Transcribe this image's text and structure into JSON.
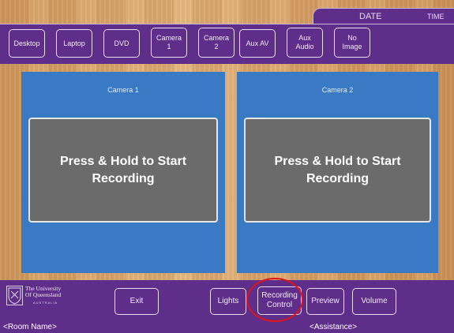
{
  "header": {
    "date_label": "DATE",
    "time_label": "TIME"
  },
  "sources": [
    {
      "label": "Desktop"
    },
    {
      "label": "Laptop"
    },
    {
      "label": "DVD"
    },
    {
      "label": "Camera\n1"
    },
    {
      "label": "Camera\n2"
    },
    {
      "label": "Aux AV"
    },
    {
      "label": "Aux\nAudio"
    },
    {
      "label": "No\nImage"
    }
  ],
  "cameras": [
    {
      "title": "Camera 1",
      "record_label": "Press & Hold to Start\nRecording"
    },
    {
      "title": "Camera 2",
      "record_label": "Press & Hold to Start\nRecording"
    }
  ],
  "footer": {
    "logo": {
      "line1": "The University",
      "line2": "Of Queensland",
      "line3": "AUSTRALIA"
    },
    "exit_label": "Exit",
    "lights_label": "Lights",
    "recording_label": "Recording\nControl",
    "preview_label": "Preview",
    "volume_label": "Volume",
    "room_name": "<Room Name>",
    "assistance": "<Assistance>"
  },
  "colors": {
    "purple": "#5f2d8a",
    "panel_blue": "#3a79c4",
    "record_grey": "#6b6b6b",
    "highlight_red": "#e01414"
  }
}
